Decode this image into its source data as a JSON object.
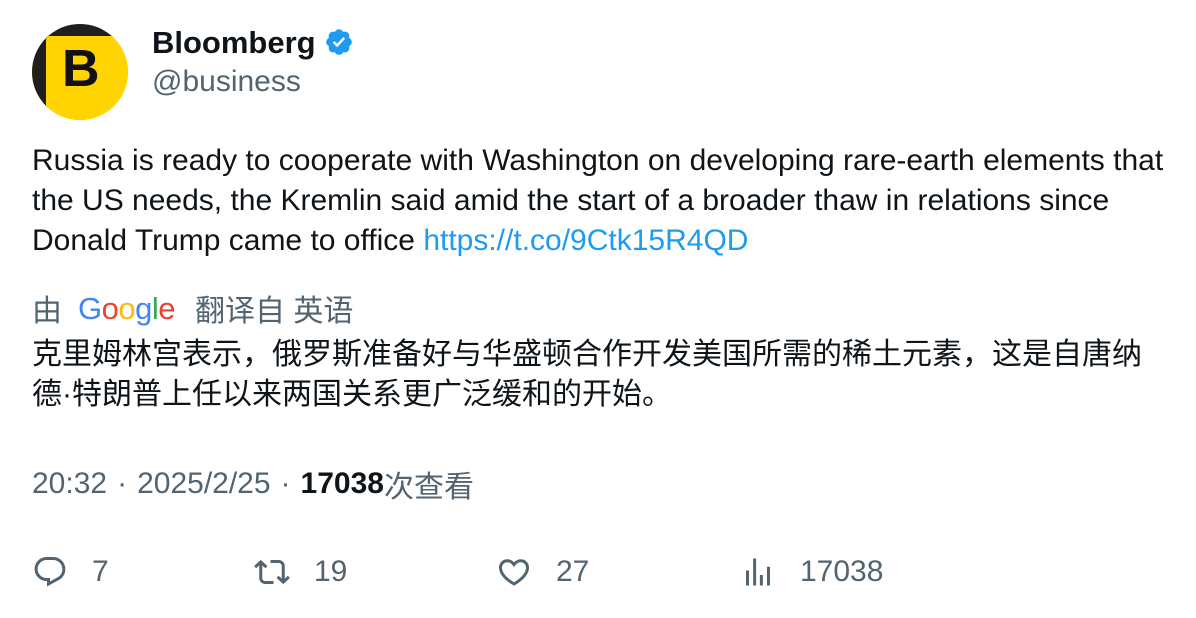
{
  "author": {
    "display_name": "Bloomberg",
    "handle": "@business",
    "avatar_letter": "B",
    "verified": true,
    "verified_color": "#1d9bf0",
    "avatar_color": "#ffd400"
  },
  "tweet": {
    "text": "Russia is ready to cooperate with Washington on developing rare-earth elements that the US needs, the Kremlin said amid the start of a broader thaw in relations since Donald Trump came to office ",
    "link": "https://t.co/9Ctk15R4QD",
    "link_color": "#1d9bf0"
  },
  "translation": {
    "prefix": "由",
    "provider_letters": [
      "G",
      "o",
      "o",
      "g",
      "l",
      "e"
    ],
    "suffix": "翻译自 英语",
    "text": "克里姆林宫表示，俄罗斯准备好与华盛顿合作开发美国所需的稀土元素，这是自唐纳德·特朗普上任以来两国关系更广泛缓和的开始。"
  },
  "meta": {
    "time": "20:32",
    "separator": "·",
    "date": "2025/2/25",
    "views_count": "17038",
    "views_label": "次查看"
  },
  "actions": {
    "reply_count": "7",
    "retweet_count": "19",
    "like_count": "27",
    "views_count": "17038"
  },
  "icons": {
    "reply": "reply-bubble-icon",
    "retweet": "retweet-icon",
    "like": "heart-icon",
    "views": "analytics-bars-icon",
    "verified": "verified-badge-icon"
  }
}
